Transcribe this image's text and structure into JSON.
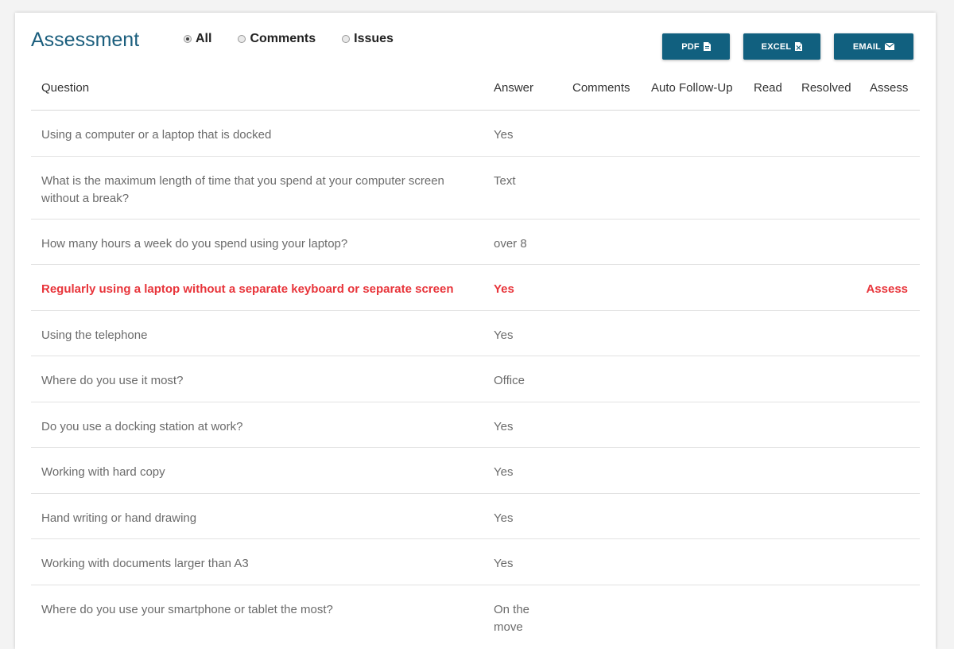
{
  "header": {
    "title": "Assessment",
    "filters": [
      {
        "label": "All",
        "selected": true
      },
      {
        "label": "Comments",
        "selected": false
      },
      {
        "label": "Issues",
        "selected": false
      }
    ],
    "buttons": {
      "pdf": "PDF",
      "excel": "EXCEL",
      "email": "EMAIL"
    },
    "icons": {
      "pdf": "file-pdf-icon",
      "excel": "file-excel-icon",
      "email": "envelope-icon"
    }
  },
  "table": {
    "columns": [
      "Question",
      "Answer",
      "Comments",
      "Auto Follow-Up",
      "Read",
      "Resolved",
      "Assess"
    ],
    "rows": [
      {
        "question": "Using a computer or a laptop that is docked",
        "answer": "Yes",
        "assess": "",
        "issue": false
      },
      {
        "question": "What is the maximum length of time that you spend at your computer screen without a break?",
        "answer": "Text",
        "assess": "",
        "issue": false
      },
      {
        "question": "How many hours a week do you spend using your laptop?",
        "answer": "over 8",
        "assess": "",
        "issue": false
      },
      {
        "question": "Regularly using a laptop without a separate keyboard or separate screen",
        "answer": "Yes",
        "assess": "Assess",
        "issue": true
      },
      {
        "question": "Using the telephone",
        "answer": "Yes",
        "assess": "",
        "issue": false
      },
      {
        "question": "Where do you use it most?",
        "answer": "Office",
        "assess": "",
        "issue": false
      },
      {
        "question": "Do you use a docking station at work?",
        "answer": "Yes",
        "assess": "",
        "issue": false
      },
      {
        "question": "Working with hard copy",
        "answer": "Yes",
        "assess": "",
        "issue": false
      },
      {
        "question": "Hand writing or hand drawing",
        "answer": "Yes",
        "assess": "",
        "issue": false
      },
      {
        "question": "Working with documents larger than A3",
        "answer": "Yes",
        "assess": "",
        "issue": false
      },
      {
        "question": "Where do you use your smartphone or tablet the most?",
        "answer": "On the move",
        "assess": "",
        "issue": false
      }
    ]
  },
  "colors": {
    "accent": "#11607f",
    "title": "#1b5e7d",
    "issue": "#e8353b"
  }
}
